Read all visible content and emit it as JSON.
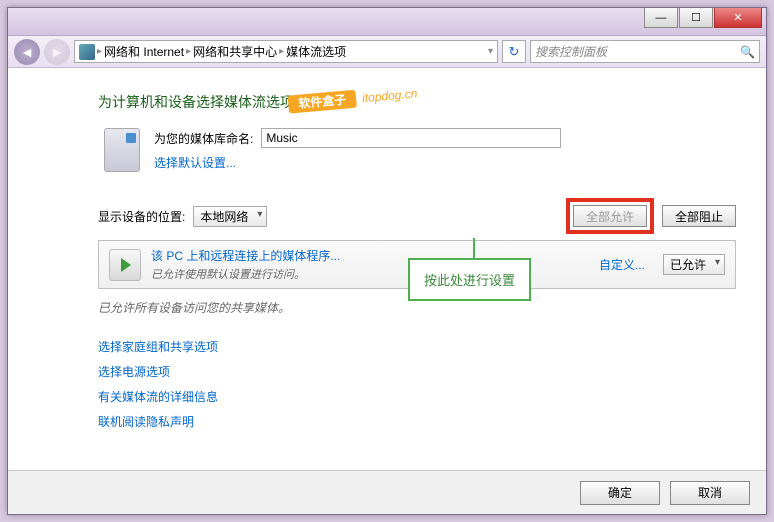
{
  "titlebar": {
    "min": "—",
    "max": "☐",
    "close": "✕"
  },
  "breadcrumb": {
    "items": [
      "网络和 Internet",
      "网络和共享中心",
      "媒体流选项"
    ]
  },
  "search": {
    "placeholder": "搜索控制面板"
  },
  "heading": "为计算机和设备选择媒体流选项",
  "library": {
    "label": "为您的媒体库命名:",
    "value": "Music",
    "defaults_link": "选择默认设置..."
  },
  "devices": {
    "label": "显示设备的位置:",
    "location_value": "本地网络",
    "allow_all": "全部允许",
    "block_all": "全部阻止"
  },
  "program_item": {
    "title": "该 PC 上和远程连接上的媒体程序...",
    "subtitle": "已允许使用默认设置进行访问。",
    "customize": "自定义...",
    "state": "已允许"
  },
  "status_line": "已允许所有设备访问您的共享媒体。",
  "links": {
    "homegroup": "选择家庭组和共享选项",
    "power": "选择电源选项",
    "details": "有关媒体流的详细信息",
    "privacy": "联机阅读隐私声明"
  },
  "callout": "按此处进行设置",
  "footer": {
    "ok": "确定",
    "cancel": "取消"
  },
  "watermark": {
    "badge": "软件盒子",
    "url": "itopdog.cn"
  }
}
